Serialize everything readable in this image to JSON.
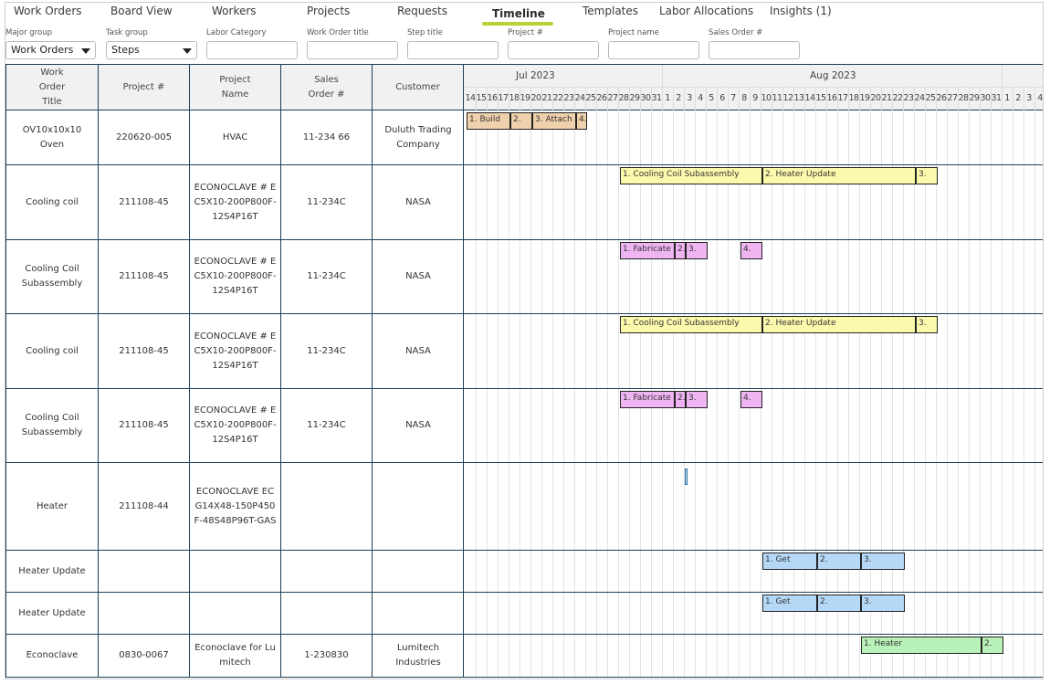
{
  "nav": {
    "tabs": [
      "Work Orders",
      "Board View",
      "Workers",
      "Projects",
      "Requests",
      "Timeline",
      "Templates",
      "Labor Allocations",
      "Insights (1)"
    ],
    "active": "Timeline"
  },
  "filters": {
    "major_group": {
      "label": "Major group",
      "value": "Work Orders"
    },
    "task_group": {
      "label": "Task group",
      "value": "Steps"
    },
    "text_filters": [
      {
        "label": "Labor Category",
        "value": ""
      },
      {
        "label": "Work Order title",
        "value": ""
      },
      {
        "label": "Step title",
        "value": ""
      },
      {
        "label": "Project #",
        "value": ""
      },
      {
        "label": "Project name",
        "value": ""
      },
      {
        "label": "Sales Order #",
        "value": ""
      }
    ]
  },
  "table": {
    "columns": [
      "Work Order Title",
      "Project #",
      "Project Name",
      "Sales Order #",
      "Customer"
    ],
    "rows": [
      [
        "OV10x10x10 Oven",
        "220620-005",
        "HVAC",
        "11-234 66",
        "Duluth Trading Company"
      ],
      [
        "Cooling coil",
        "211108-45",
        "ECONOCLAVE # EC5X10-200P800F-12S4P16T",
        "11-234C",
        "NASA"
      ],
      [
        "Cooling Coil Subassembly",
        "211108-45",
        "ECONOCLAVE # EC5X10-200P800F-12S4P16T",
        "11-234C",
        "NASA"
      ],
      [
        "Cooling coil",
        "211108-45",
        "ECONOCLAVE # EC5X10-200P800F-12S4P16T",
        "11-234C",
        "NASA"
      ],
      [
        "Cooling Coil Subassembly",
        "211108-45",
        "ECONOCLAVE # EC5X10-200P800F-12S4P16T",
        "11-234C",
        "NASA"
      ],
      [
        "Heater",
        "211108-44",
        "ECONOCLAVE ECG14X48-150P450F-48S48P96T-GAS",
        "",
        ""
      ],
      [
        "Heater Update",
        "",
        "",
        "",
        ""
      ],
      [
        "Heater Update",
        "",
        "",
        "",
        ""
      ],
      [
        "Econoclave",
        "0830-0067",
        "Econoclave for Lumitech",
        "1-230830",
        "Lumitech Industries"
      ]
    ]
  },
  "timeline": {
    "months": [
      "Jul 2023",
      "Aug 2023"
    ],
    "days": [
      14,
      15,
      16,
      17,
      18,
      19,
      20,
      21,
      22,
      23,
      24,
      25,
      26,
      27,
      28,
      29,
      30,
      31,
      1,
      2,
      3,
      4,
      5,
      6,
      7,
      8,
      9,
      10,
      11,
      12,
      13,
      14,
      15,
      16,
      17,
      18,
      19,
      20,
      21,
      22,
      23,
      24,
      25,
      26,
      27,
      28,
      29,
      30,
      31,
      1,
      2,
      3,
      4
    ],
    "colors": {
      "orange": "#f0d1ad",
      "yellow": "#fbf9ac",
      "pink": "#efb4f2",
      "blue": "#b4d8f6",
      "green": "#b8f2b8",
      "grid": "#1d3f55"
    },
    "rows": [
      [
        {
          "label": "1. Build",
          "start": "2023-07-14",
          "end": "2023-07-18",
          "color": "orange"
        },
        {
          "label": "2.",
          "start": "2023-07-18",
          "end": "2023-07-20",
          "color": "orange"
        },
        {
          "label": "3. Attach",
          "start": "2023-07-20",
          "end": "2023-07-24",
          "color": "orange"
        },
        {
          "label": "4.",
          "start": "2023-07-24",
          "end": "2023-07-25",
          "color": "orange"
        }
      ],
      [
        {
          "label": "1. Cooling Coil Subassembly",
          "start": "2023-07-28",
          "end": "2023-08-10",
          "color": "yellow"
        },
        {
          "label": "2. Heater Update",
          "start": "2023-08-10",
          "end": "2023-08-24",
          "color": "yellow"
        },
        {
          "label": "3.",
          "start": "2023-08-24",
          "end": "2023-08-26",
          "color": "yellow"
        }
      ],
      [
        {
          "label": "1. Fabricate",
          "start": "2023-07-28",
          "end": "2023-08-02",
          "color": "pink"
        },
        {
          "label": "2.",
          "start": "2023-08-02",
          "end": "2023-08-03",
          "color": "pink"
        },
        {
          "label": "3.",
          "start": "2023-08-03",
          "end": "2023-08-05",
          "color": "pink"
        },
        {
          "label": "4.",
          "start": "2023-08-08",
          "end": "2023-08-10",
          "color": "pink"
        }
      ],
      [
        {
          "label": "1. Cooling Coil Subassembly",
          "start": "2023-07-28",
          "end": "2023-08-10",
          "color": "yellow"
        },
        {
          "label": "2. Heater Update",
          "start": "2023-08-10",
          "end": "2023-08-24",
          "color": "yellow"
        },
        {
          "label": "3.",
          "start": "2023-08-24",
          "end": "2023-08-26",
          "color": "yellow"
        }
      ],
      [
        {
          "label": "1. Fabricate",
          "start": "2023-07-28",
          "end": "2023-08-02",
          "color": "pink"
        },
        {
          "label": "2.",
          "start": "2023-08-02",
          "end": "2023-08-03",
          "color": "pink"
        },
        {
          "label": "3.",
          "start": "2023-08-03",
          "end": "2023-08-05",
          "color": "pink"
        },
        {
          "label": "4.",
          "start": "2023-08-08",
          "end": "2023-08-10",
          "color": "pink"
        }
      ],
      [
        {
          "label": "",
          "start": "2023-08-03",
          "end": "2023-08-03",
          "color": "blue",
          "marker": true
        }
      ],
      [
        {
          "label": "1. Get",
          "start": "2023-08-10",
          "end": "2023-08-15",
          "color": "blue"
        },
        {
          "label": "2.",
          "start": "2023-08-15",
          "end": "2023-08-19",
          "color": "blue"
        },
        {
          "label": "3.",
          "start": "2023-08-19",
          "end": "2023-08-23",
          "color": "blue"
        }
      ],
      [
        {
          "label": "1. Get",
          "start": "2023-08-10",
          "end": "2023-08-15",
          "color": "blue"
        },
        {
          "label": "2.",
          "start": "2023-08-15",
          "end": "2023-08-19",
          "color": "blue"
        },
        {
          "label": "3.",
          "start": "2023-08-19",
          "end": "2023-08-23",
          "color": "blue"
        }
      ],
      [
        {
          "label": "1. Heater",
          "start": "2023-08-19",
          "end": "2023-08-30",
          "color": "green"
        },
        {
          "label": "2.",
          "start": "2023-08-30",
          "end": "2023-09-01",
          "color": "green"
        }
      ]
    ]
  }
}
